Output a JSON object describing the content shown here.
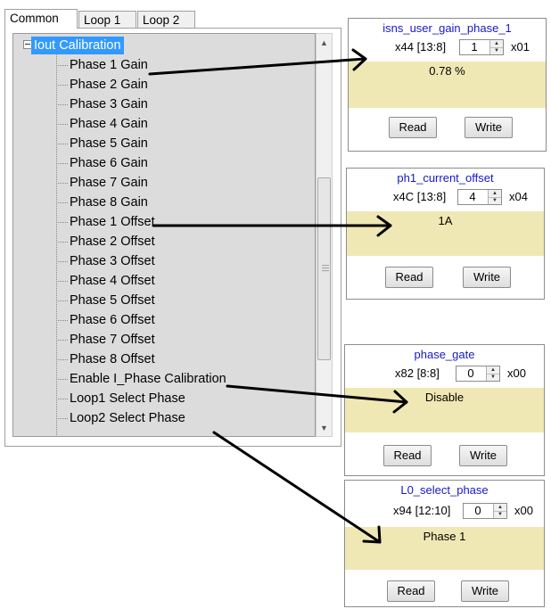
{
  "tabs": [
    {
      "label": "Common",
      "active": true
    },
    {
      "label": "Loop 1",
      "active": false
    },
    {
      "label": "Loop 2",
      "active": false
    }
  ],
  "tree": {
    "root": "Iout Calibration",
    "items": [
      "Phase 1 Gain",
      "Phase 2 Gain",
      "Phase 3 Gain",
      "Phase 4 Gain",
      "Phase 5 Gain",
      "Phase 6 Gain",
      "Phase 7 Gain",
      "Phase 8 Gain",
      "Phase 1 Offset",
      "Phase 2 Offset",
      "Phase 3 Offset",
      "Phase 4 Offset",
      "Phase 5 Offset",
      "Phase 6 Offset",
      "Phase 7 Offset",
      "Phase 8 Offset",
      "Enable I_Phase Calibration",
      "Loop1 Select Phase",
      "Loop2 Select Phase"
    ]
  },
  "panels": [
    {
      "name": "isns_user_gain_phase_1",
      "addr": "x44 [13:8]",
      "spin": "1",
      "hex": "x01",
      "value": "0.78 %",
      "read": "Read",
      "write": "Write"
    },
    {
      "name": "ph1_current_offset",
      "addr": "x4C [13:8]",
      "spin": "4",
      "hex": "x04",
      "value": "1A",
      "read": "Read",
      "write": "Write"
    },
    {
      "name": "phase_gate",
      "addr": "x82 [8:8]",
      "spin": "0",
      "hex": "x00",
      "value": "Disable",
      "read": "Read",
      "write": "Write"
    },
    {
      "name": "L0_select_phase",
      "addr": "x94 [12:10]",
      "spin": "0",
      "hex": "x00",
      "value": "Phase 1",
      "read": "Read",
      "write": "Write"
    }
  ],
  "colors": {
    "selection": "#3399ff",
    "value_bg": "#f0e8b4",
    "register_name": "#1818c8"
  },
  "icons": [
    "collapse-icon",
    "scroll-up-icon",
    "scroll-down-icon",
    "spin-up-icon",
    "spin-down-icon",
    "arrow-icon"
  ]
}
